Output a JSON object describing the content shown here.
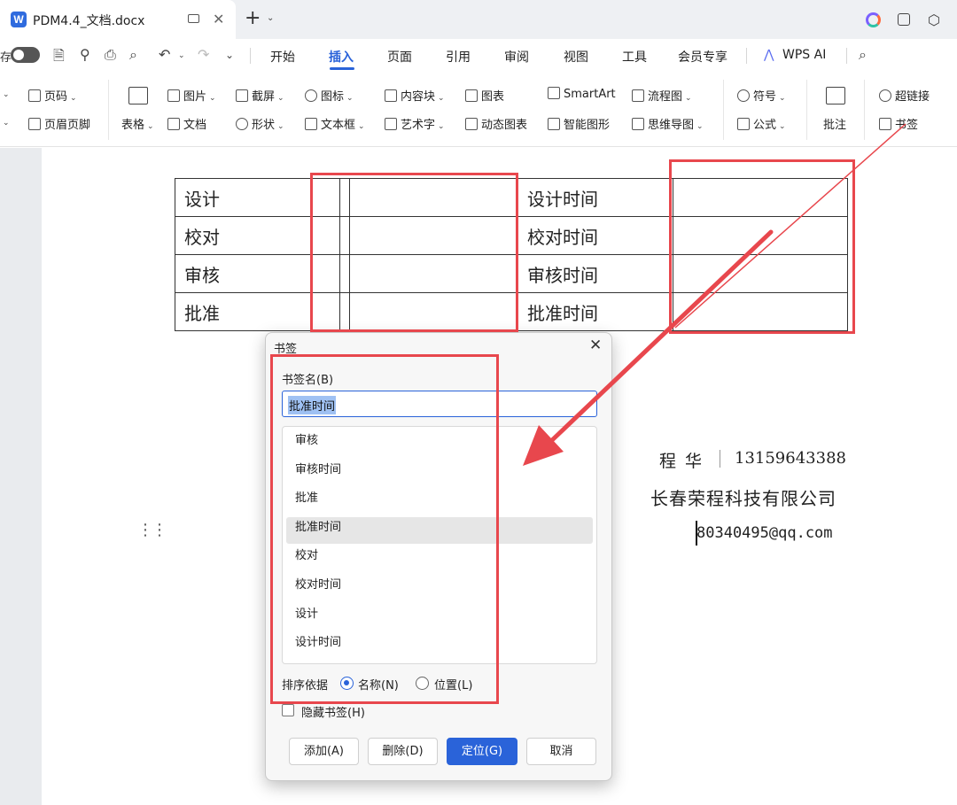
{
  "titlebar": {
    "logo_letter": "W",
    "doc_title": "PDM4.4_文档.docx",
    "close_glyph": "✕",
    "new_tab_glyph": "+",
    "dropdown_glyph": "⌄"
  },
  "menubar": {
    "autosave_label": "存",
    "tabs": [
      "开始",
      "插入",
      "页面",
      "引用",
      "审阅",
      "视图",
      "工具",
      "会员专享"
    ],
    "active_tab": "插入",
    "wps_ai": "WPS AI"
  },
  "ribbon": {
    "page_number": "页码",
    "header_footer": "页眉页脚",
    "table": "表格",
    "picture": "图片",
    "document": "文档",
    "screenshot": "截屏",
    "shape": "形状",
    "icon": "图标",
    "textbox": "文本框",
    "content_block": "内容块",
    "art_text": "艺术字",
    "chart": "图表",
    "dynamic_chart": "动态图表",
    "smartart": "SmartArt",
    "smart_shape": "智能图形",
    "flowchart": "流程图",
    "mindmap": "思维导图",
    "symbol": "符号",
    "formula": "公式",
    "comment": "批注",
    "hyperlink": "超链接",
    "bookmark": "书签"
  },
  "doc": {
    "table": {
      "rows": [
        {
          "label": "设计",
          "time_label": "设计时间"
        },
        {
          "label": "校对",
          "time_label": "校对时间"
        },
        {
          "label": "审核",
          "time_label": "审核时间"
        },
        {
          "label": "批准",
          "time_label": "批准时间"
        }
      ]
    },
    "contact": {
      "name": "程 华",
      "phone": "13159643388",
      "company": "长春荣程科技有限公司",
      "email": "80340495@qq.com"
    }
  },
  "dialog": {
    "title": "书签",
    "close_glyph": "✕",
    "name_label": "书签名(B)",
    "name_value": "批准时间",
    "items": [
      "审核",
      "审核时间",
      "批准",
      "批准时间",
      "校对",
      "校对时间",
      "设计",
      "设计时间"
    ],
    "selected_item": "批准时间",
    "sort_label": "排序依据",
    "sort_by_name": "名称(N)",
    "sort_by_position": "位置(L)",
    "sort_selected": "名称(N)",
    "hide_bookmarks": "隐藏书签(H)",
    "hide_checked": false,
    "buttons": {
      "add": "添加(A)",
      "delete": "删除(D)",
      "locate": "定位(G)",
      "cancel": "取消"
    }
  },
  "colors": {
    "accent": "#2a63d9",
    "annotation": "#e8474d",
    "selection": "#9fc1f3"
  }
}
